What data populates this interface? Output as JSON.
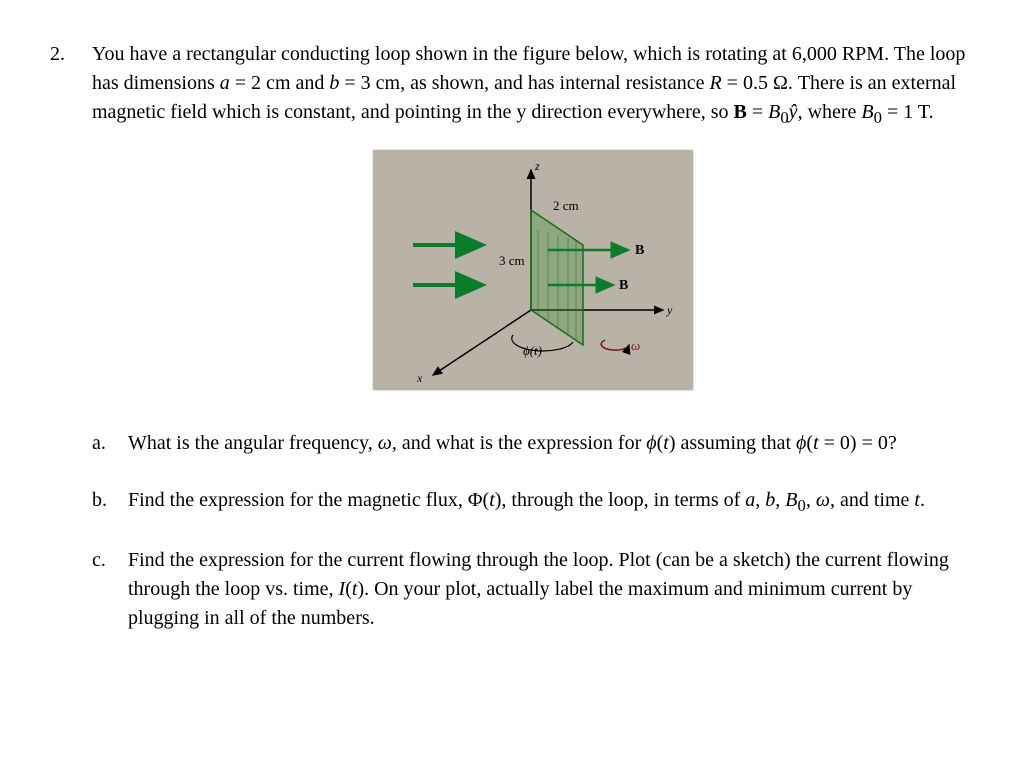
{
  "problem_number": "2.",
  "stem_html": "You have a rectangular conducting loop shown in the figure below, which is rotating at 6,000 RPM. The loop has dimensions <span class='math-i'>a</span> = 2 cm and <span class='math-i'>b</span> = 3 cm, as shown, and has internal resistance <span class='math-i'>R</span> = 0.5 Ω. There is an external magnetic field which is constant, and pointing in the y direction everywhere, so <span class='bold'>B</span> = <span class='math-i'>B</span><sub>0</sub><span class='math-i'>ŷ</span>, where <span class='math-i'>B</span><sub>0</sub> = 1 T.",
  "figure": {
    "axis_z": "z",
    "axis_y": "y",
    "axis_x": "x",
    "dim_a": "2 cm",
    "dim_b": "3 cm",
    "B_label": "B",
    "phi_label": "ϕ(t)",
    "omega_label": "ω"
  },
  "subparts": [
    {
      "letter": "a.",
      "text_html": "What is the angular frequency, <span class='math-i'>ω</span>, and what is the expression for <span class='math-i'>ϕ</span>(<span class='math-i'>t</span>) assuming that <span class='math-i'>ϕ</span>(<span class='math-i'>t</span> = 0) = 0?"
    },
    {
      "letter": "b.",
      "text_html": "Find the expression for the magnetic flux, Φ(<span class='math-i'>t</span>), through the loop, in terms of <span class='math-i'>a</span>, <span class='math-i'>b</span>, <span class='math-i'>B</span><sub>0</sub>, <span class='math-i'>ω</span>, and time <span class='math-i'>t</span>."
    },
    {
      "letter": "c.",
      "text_html": "Find the expression for the current flowing through the loop. Plot (can be a sketch) the current flowing through the loop vs. time, <span class='math-i'>I</span>(<span class='math-i'>t</span>). On your plot, actually label the maximum and minimum current by plugging in all of the numbers."
    }
  ]
}
